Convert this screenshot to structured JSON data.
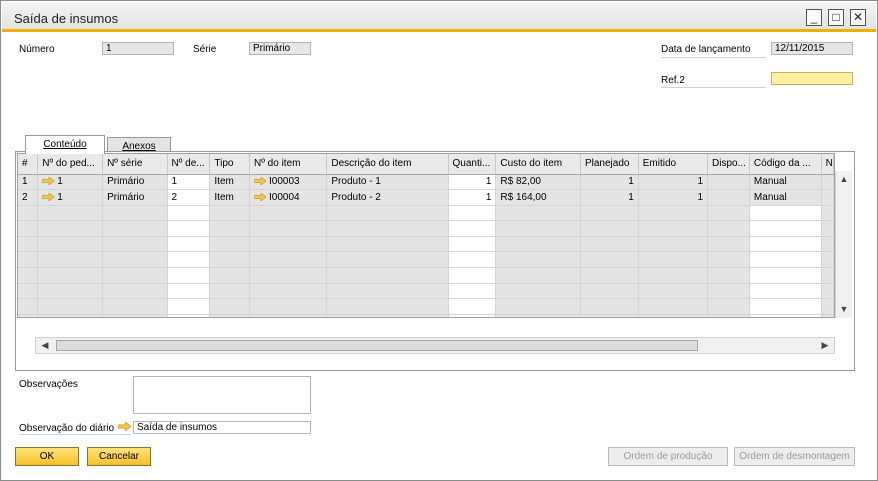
{
  "window": {
    "title": "Saída de insumos"
  },
  "header": {
    "numero_label": "Número",
    "numero_value": "1",
    "serie_label": "Série",
    "serie_value": "Primário",
    "data_label": "Data de lançamento",
    "data_value": "12/11/2015",
    "ref2_label": "Ref.2",
    "ref2_value": ""
  },
  "tabs": [
    {
      "label": "Conteúdo",
      "active": true
    },
    {
      "label": "Anexos",
      "active": false
    }
  ],
  "table": {
    "columns": [
      "#",
      "Nº do ped...",
      "Nº série",
      "Nº de...",
      "Tipo",
      "Nº do item",
      "Descrição do item",
      "Quanti...",
      "Custo do item",
      "Planejado",
      "Emitido",
      "Dispo...",
      "Código da ...",
      "N"
    ],
    "rows": [
      {
        "idx": "1",
        "pedido": "1",
        "serie": "Primário",
        "nde": "1",
        "tipo": "Item",
        "item": "I00003",
        "descricao": "Produto - 1",
        "quantidade": "1",
        "custo": "R$ 82,00",
        "planejado": "1",
        "emitido": "1",
        "dispo": "",
        "codigo": "Manual"
      },
      {
        "idx": "2",
        "pedido": "1",
        "serie": "Primário",
        "nde": "2",
        "tipo": "Item",
        "item": "I00004",
        "descricao": "Produto - 2",
        "quantidade": "1",
        "custo": "R$ 164,00",
        "planejado": "1",
        "emitido": "1",
        "dispo": "",
        "codigo": "Manual"
      }
    ]
  },
  "footer": {
    "observacoes_label": "Observações",
    "observacoes_value": "",
    "obs_diario_label": "Observação do diário",
    "obs_diario_value": "Saída de insumos"
  },
  "buttons": {
    "ok": "OK",
    "cancelar": "Cancelar",
    "ordem_producao": "Ordem de produção",
    "ordem_desmontagem": "Ordem de desmontagem"
  },
  "colors": {
    "accent": "#f0b000",
    "button": "#f5c12a",
    "ref_field": "#fff0a0"
  },
  "icons": {
    "link_arrow": "link-arrow-icon"
  }
}
